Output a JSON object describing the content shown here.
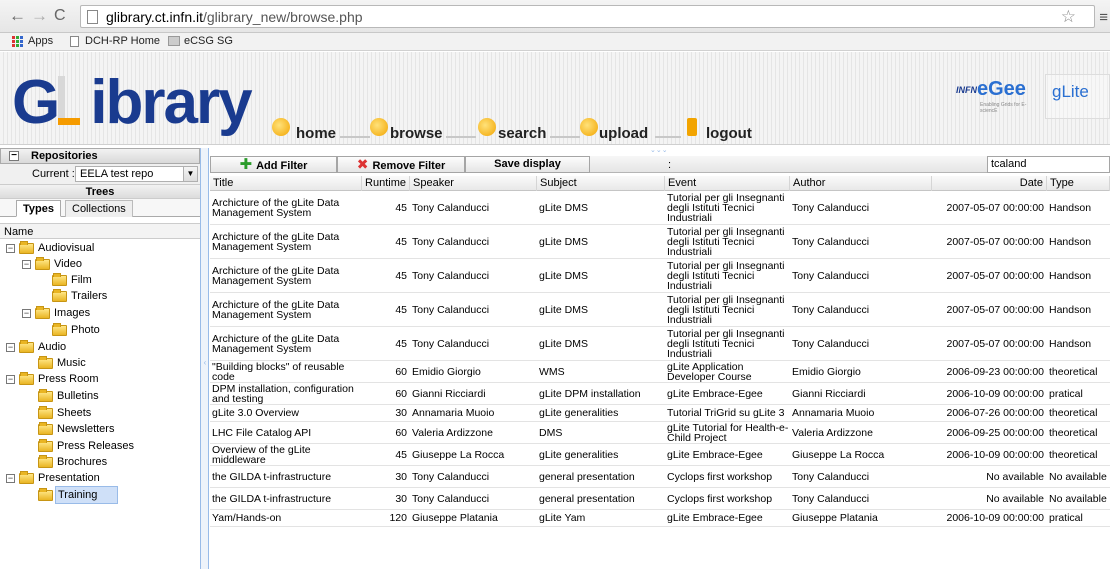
{
  "browser": {
    "url_host": "glibrary.ct.infn.it",
    "url_path": "/glibrary_new/browse.php",
    "bookmarks": [
      "Apps",
      "DCH-RP Home",
      "eCSG SG"
    ]
  },
  "site": {
    "logo": "GLibrary",
    "nav": [
      "home",
      "browse",
      "search",
      "upload",
      "logout"
    ],
    "partners": [
      "INFN",
      "eGee",
      "gLite"
    ],
    "partner_sub": "Enabling Grids for E-sciencE"
  },
  "sidebar": {
    "repositories_title": "Repositories",
    "current_label": "Current :",
    "current_value": "EELA test repo",
    "trees_title": "Trees",
    "tabs": [
      "Types",
      "Collections"
    ],
    "tree_header": "Name",
    "nodes": [
      {
        "label": "Audiovisual",
        "toggle": "−"
      },
      {
        "label": "Video",
        "toggle": "−"
      },
      {
        "label": "Film",
        "toggle": ""
      },
      {
        "label": "Trailers",
        "toggle": ""
      },
      {
        "label": "Images",
        "toggle": "−"
      },
      {
        "label": "Photo",
        "toggle": ""
      },
      {
        "label": "Audio",
        "toggle": "−"
      },
      {
        "label": "Music",
        "toggle": ""
      },
      {
        "label": "Press Room",
        "toggle": "−"
      },
      {
        "label": "Bulletins",
        "toggle": ""
      },
      {
        "label": "Sheets",
        "toggle": ""
      },
      {
        "label": "Newsletters",
        "toggle": ""
      },
      {
        "label": "Press Releases",
        "toggle": ""
      },
      {
        "label": "Brochures",
        "toggle": ""
      },
      {
        "label": "Presentation",
        "toggle": "−"
      },
      {
        "label": "Training",
        "toggle": ""
      }
    ]
  },
  "toolbar": {
    "add_filter": "Add Filter",
    "remove_filter": "Remove Filter",
    "save_display": "Save display",
    "colon": ":",
    "search_value": "tcaland"
  },
  "grid": {
    "columns": [
      "Title",
      "Runtime",
      "Speaker",
      "Subject",
      "Event",
      "Author",
      "Date",
      "Type"
    ],
    "rows": [
      [
        "Archicture of the gLite Data Management System",
        "45",
        "Tony Calanducci",
        "gLite DMS",
        "Tutorial per gli Insegnanti degli Istituti Tecnici Industriali",
        "Tony Calanducci",
        "2007-05-07 00:00:00",
        "Handson"
      ],
      [
        "Archicture of the gLite Data Management System",
        "45",
        "Tony Calanducci",
        "gLite DMS",
        "Tutorial per gli Insegnanti degli Istituti Tecnici Industriali",
        "Tony Calanducci",
        "2007-05-07 00:00:00",
        "Handson"
      ],
      [
        "Archicture of the gLite Data Management System",
        "45",
        "Tony Calanducci",
        "gLite DMS",
        "Tutorial per gli Insegnanti degli Istituti Tecnici Industriali",
        "Tony Calanducci",
        "2007-05-07 00:00:00",
        "Handson"
      ],
      [
        "Archicture of the gLite Data Management System",
        "45",
        "Tony Calanducci",
        "gLite DMS",
        "Tutorial per gli Insegnanti degli Istituti Tecnici Industriali",
        "Tony Calanducci",
        "2007-05-07 00:00:00",
        "Handson"
      ],
      [
        "Archicture of the gLite Data Management System",
        "45",
        "Tony Calanducci",
        "gLite DMS",
        "Tutorial per gli Insegnanti degli Istituti Tecnici Industriali",
        "Tony Calanducci",
        "2007-05-07 00:00:00",
        "Handson"
      ],
      [
        "\"Building blocks\" of reusable code",
        "60",
        "Emidio Giorgio",
        "WMS",
        "gLite Application Developer Course",
        "Emidio Giorgio",
        "2006-09-23 00:00:00",
        "theoretical"
      ],
      [
        "DPM installation, configuration and testing",
        "60",
        "Gianni Ricciardi",
        "gLite DPM installation",
        "gLite Embrace-Egee",
        "Gianni Ricciardi",
        "2006-10-09 00:00:00",
        "pratical"
      ],
      [
        "gLite 3.0 Overview",
        "30",
        "Annamaria Muoio",
        "gLite generalities",
        "Tutorial TriGrid su gLite 3",
        "Annamaria Muoio",
        "2006-07-26 00:00:00",
        "theoretical"
      ],
      [
        "LHC File Catalog API",
        "60",
        "Valeria Ardizzone",
        "DMS",
        "gLite Tutorial for Health-e-Child Project",
        "Valeria Ardizzone",
        "2006-09-25 00:00:00",
        "theoretical"
      ],
      [
        "Overview of the gLite middleware",
        "45",
        "Giuseppe La Rocca",
        "gLite generalities",
        "gLite Embrace-Egee",
        "Giuseppe La Rocca",
        "2006-10-09 00:00:00",
        "theoretical"
      ],
      [
        "the GILDA t-infrastructure",
        "30",
        "Tony Calanducci",
        "general presentation",
        "Cyclops first workshop",
        "Tony Calanducci",
        "No available",
        "No available"
      ],
      [
        "the GILDA t-infrastructure",
        "30",
        "Tony Calanducci",
        "general presentation",
        "Cyclops first workshop",
        "Tony Calanducci",
        "No available",
        "No available"
      ],
      [
        "Yam/Hands-on",
        "120",
        "Giuseppe Platania",
        "gLite Yam",
        "gLite Embrace-Egee",
        "Giuseppe Platania",
        "2006-10-09 00:00:00",
        "pratical"
      ]
    ]
  }
}
